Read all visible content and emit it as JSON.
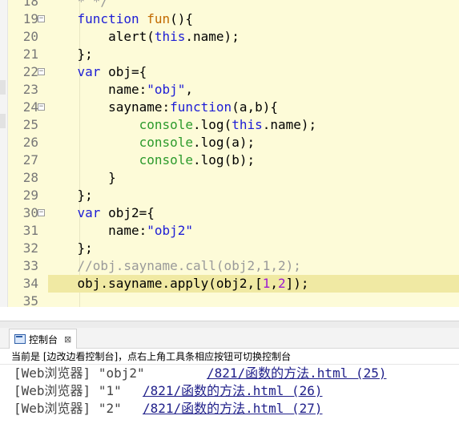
{
  "editor": {
    "lines": [
      {
        "num": "18",
        "fold": false,
        "tokens": [
          {
            "t": "    * */",
            "c": "cmt"
          }
        ]
      },
      {
        "num": "19",
        "fold": true,
        "tokens": [
          {
            "t": "    ",
            "c": ""
          },
          {
            "t": "function",
            "c": "kw"
          },
          {
            "t": " ",
            "c": ""
          },
          {
            "t": "fun",
            "c": "fn"
          },
          {
            "t": "(){",
            "c": ""
          }
        ]
      },
      {
        "num": "20",
        "fold": false,
        "tokens": [
          {
            "t": "        alert(",
            "c": ""
          },
          {
            "t": "this",
            "c": "this"
          },
          {
            "t": ".name);",
            "c": ""
          }
        ]
      },
      {
        "num": "21",
        "fold": false,
        "tokens": [
          {
            "t": "    };",
            "c": ""
          }
        ]
      },
      {
        "num": "22",
        "fold": true,
        "tokens": [
          {
            "t": "    ",
            "c": ""
          },
          {
            "t": "var",
            "c": "kw"
          },
          {
            "t": " obj={",
            "c": ""
          }
        ]
      },
      {
        "num": "23",
        "fold": false,
        "tokens": [
          {
            "t": "        name:",
            "c": ""
          },
          {
            "t": "\"obj\"",
            "c": "str"
          },
          {
            "t": ",",
            "c": ""
          }
        ]
      },
      {
        "num": "24",
        "fold": true,
        "tokens": [
          {
            "t": "        sayname:",
            "c": ""
          },
          {
            "t": "function",
            "c": "kw"
          },
          {
            "t": "(a,b){",
            "c": ""
          }
        ]
      },
      {
        "num": "25",
        "fold": false,
        "tokens": [
          {
            "t": "            ",
            "c": ""
          },
          {
            "t": "console",
            "c": "con"
          },
          {
            "t": ".log(",
            "c": ""
          },
          {
            "t": "this",
            "c": "this"
          },
          {
            "t": ".name);",
            "c": ""
          }
        ]
      },
      {
        "num": "26",
        "fold": false,
        "tokens": [
          {
            "t": "            ",
            "c": ""
          },
          {
            "t": "console",
            "c": "con"
          },
          {
            "t": ".log(a);",
            "c": ""
          }
        ]
      },
      {
        "num": "27",
        "fold": false,
        "tokens": [
          {
            "t": "            ",
            "c": ""
          },
          {
            "t": "console",
            "c": "con"
          },
          {
            "t": ".log(b);",
            "c": ""
          }
        ]
      },
      {
        "num": "28",
        "fold": false,
        "tokens": [
          {
            "t": "        }",
            "c": ""
          }
        ]
      },
      {
        "num": "29",
        "fold": false,
        "tokens": [
          {
            "t": "    };",
            "c": ""
          }
        ]
      },
      {
        "num": "30",
        "fold": true,
        "tokens": [
          {
            "t": "    ",
            "c": ""
          },
          {
            "t": "var",
            "c": "kw"
          },
          {
            "t": " obj2={",
            "c": ""
          }
        ]
      },
      {
        "num": "31",
        "fold": false,
        "tokens": [
          {
            "t": "        name:",
            "c": ""
          },
          {
            "t": "\"obj2\"",
            "c": "str"
          }
        ]
      },
      {
        "num": "32",
        "fold": false,
        "tokens": [
          {
            "t": "    };",
            "c": ""
          }
        ]
      },
      {
        "num": "33",
        "fold": false,
        "tokens": [
          {
            "t": "    //obj.sayname.call(obj2,1,2);",
            "c": "cmt"
          }
        ]
      },
      {
        "num": "34",
        "fold": false,
        "highlight": true,
        "tokens": [
          {
            "t": "    obj.sayname.apply(obj2,[",
            "c": ""
          },
          {
            "t": "1",
            "c": "num"
          },
          {
            "t": ",",
            "c": ""
          },
          {
            "t": "2",
            "c": "num"
          },
          {
            "t": "]);",
            "c": ""
          }
        ]
      },
      {
        "num": "35",
        "fold": false,
        "tokens": []
      }
    ],
    "scroll_arrow": "<"
  },
  "console": {
    "tab_label": "控制台",
    "close_symbol": "⊠",
    "status": "当前是 [边改边看控制台]，点右上角工具条相应按钮可切换控制台",
    "logs": [
      {
        "source": "[Web浏览器]",
        "value": "\"obj2\"",
        "link": "/821/函数的方法.html (25)"
      },
      {
        "source": "[Web浏览器]",
        "value": "\"1\"",
        "link": "/821/函数的方法.html (26)"
      },
      {
        "source": "[Web浏览器]",
        "value": "\"2\"",
        "link": "/821/函数的方法.html (27)"
      }
    ]
  },
  "colors": {
    "editor_bg": "#fdfbd8",
    "keyword": "#1d1dd6",
    "function_name": "#c26a00",
    "console_obj": "#2c9a2c",
    "number": "#9c1ad0",
    "comment": "#9a9a9a",
    "current_line": "#f0e9a3",
    "link": "#20208a"
  }
}
